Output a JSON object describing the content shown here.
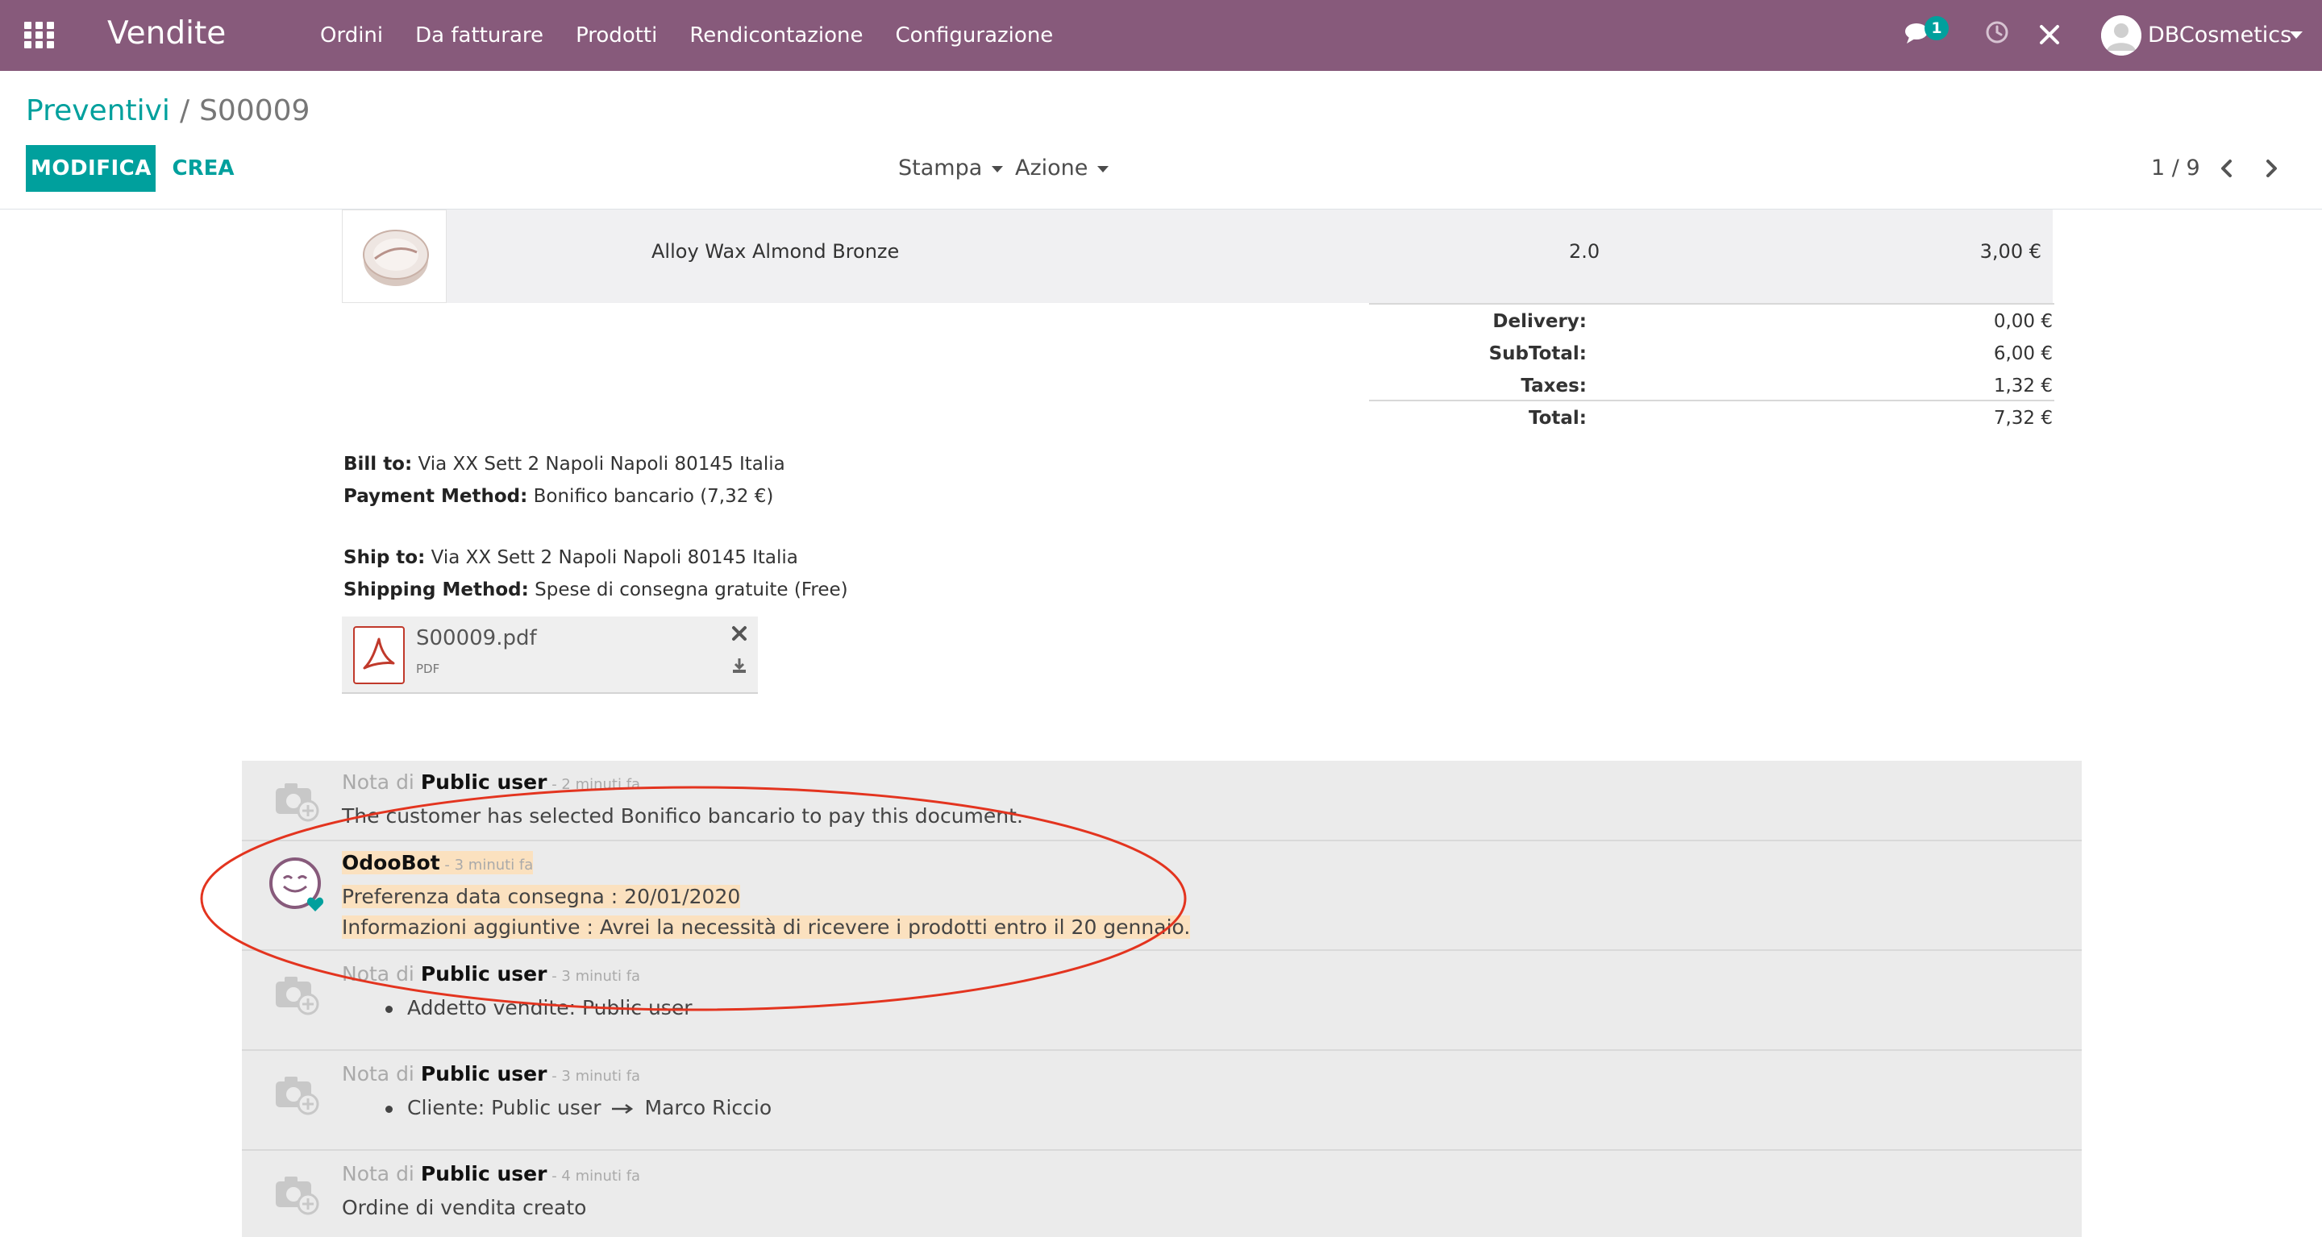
{
  "navbar": {
    "app_title": "Vendite",
    "menu": [
      "Ordini",
      "Da fatturare",
      "Prodotti",
      "Rendicontazione",
      "Configurazione"
    ],
    "messages_badge": "1",
    "user_name": "DBCosmetics",
    "color": "#875a7b"
  },
  "control_panel": {
    "breadcrumb_parent": "Preventivi",
    "breadcrumb_separator": "/",
    "breadcrumb_current": "S00009",
    "edit_label": "MODIFICA",
    "create_label": "CREA",
    "print_label": "Stampa",
    "action_label": "Azione",
    "pager": "1 / 9",
    "accent": "#00a09d"
  },
  "order_line": {
    "product_name": "Alloy Wax Almond Bronze",
    "quantity": "2.0",
    "price": "3,00 €"
  },
  "totals": [
    {
      "label": "Delivery:",
      "value": "0,00 €"
    },
    {
      "label": "SubTotal:",
      "value": "6,00 €"
    },
    {
      "label": "Taxes:",
      "value": "1,32 €"
    },
    {
      "label": "Total:",
      "value": "7,32 €"
    }
  ],
  "addresses": {
    "bill_to_label": "Bill to:",
    "bill_to": " Via XX Sett 2 Napoli Napoli 80145 Italia",
    "payment_label": "Payment Method:",
    "payment": " Bonifico bancario (7,32 €)",
    "ship_to_label": "Ship to:",
    "ship_to": " Via XX Sett 2 Napoli Napoli 80145 Italia",
    "shipping_label": "Shipping Method:",
    "shipping": " Spese di consegna gratuite (Free)"
  },
  "attachment": {
    "name": "S00009.pdf",
    "type": "PDF"
  },
  "chatter": {
    "note_prefix": "Nota di ",
    "messages": [
      {
        "author": "Public user",
        "ago": " - 2 minuti fa",
        "body": "The customer has selected Bonifico bancario to pay this document."
      },
      {
        "author": "OdooBot",
        "ago": " - 3 minuti fa",
        "line1": "Preferenza data consegna : 20/01/2020",
        "line2": "Informazioni aggiuntive : Avrei la necessità di ricevere i prodotti entro il 20 gennaio."
      },
      {
        "author": "Public user",
        "ago": " - 3 minuti fa",
        "body": "Addetto vendite: Public user"
      },
      {
        "author": "Public user",
        "ago": " - 3 minuti fa",
        "body_from": "Cliente: Public user",
        "body_to": "Marco Riccio"
      },
      {
        "author": "Public user",
        "ago": " - 4 minuti fa",
        "body": "Ordine di vendita creato"
      }
    ],
    "highlight_color": "#fbe1bf",
    "annotation_color": "#e3341f"
  }
}
